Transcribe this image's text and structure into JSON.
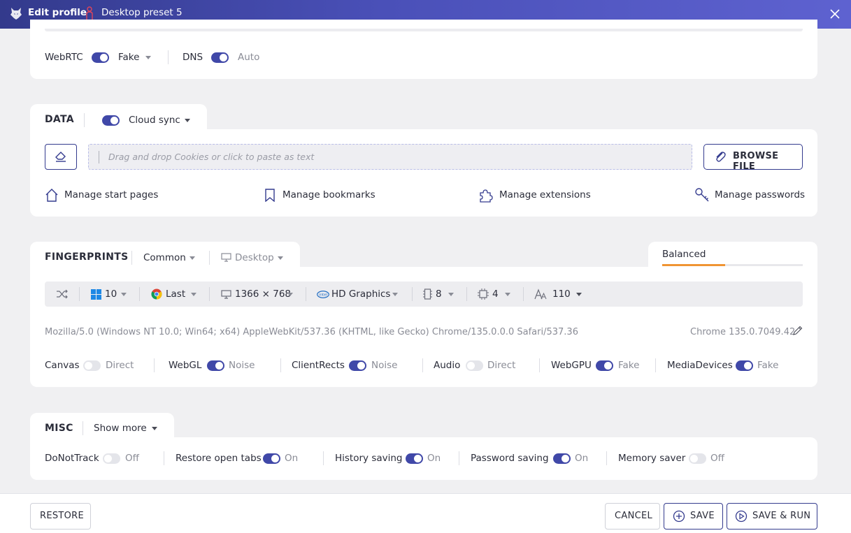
{
  "header": {
    "title": "Edit profile",
    "preset": "Desktop preset 5"
  },
  "network": {
    "webrtc_label": "WebRTC",
    "webrtc_on": true,
    "webrtc_value": "Fake",
    "dns_label": "DNS",
    "dns_on": true,
    "dns_value": "Auto"
  },
  "data": {
    "title": "DATA",
    "cloud_sync_on": true,
    "cloud_sync_label": "Cloud sync",
    "cookies_placeholder": "Drag and drop Cookies or click to paste as text",
    "browse_label": "BROWSE FILE",
    "links": {
      "start_pages": "Manage start pages",
      "bookmarks": "Manage bookmarks",
      "extensions": "Manage extensions",
      "passwords": "Manage passwords"
    }
  },
  "fingerprints": {
    "title": "FINGERPRINTS",
    "mode": "Common",
    "device": "Desktop",
    "balance_label": "Balanced",
    "balance_level_percent": 45,
    "os_version": "10",
    "browser_version": "Last",
    "resolution": "1366 × 768",
    "gpu": "HD Graphics",
    "memory": "8",
    "cpu_cores": "4",
    "fonts_count": "110",
    "user_agent": "Mozilla/5.0 (Windows NT 10.0; Win64; x64) AppleWebKit/537.36 (KHTML, like Gecko) Chrome/135.0.0.0 Safari/537.36",
    "browser_name": "Chrome 135.0.7049.42",
    "toggles": [
      {
        "label": "Canvas",
        "on": false,
        "value": "Direct"
      },
      {
        "label": "WebGL",
        "on": true,
        "value": "Noise"
      },
      {
        "label": "ClientRects",
        "on": true,
        "value": "Noise"
      },
      {
        "label": "Audio",
        "on": false,
        "value": "Direct"
      },
      {
        "label": "WebGPU",
        "on": true,
        "value": "Fake"
      },
      {
        "label": "MediaDevices",
        "on": true,
        "value": "Fake"
      }
    ]
  },
  "misc": {
    "title": "MISC",
    "show_more": "Show more",
    "toggles": [
      {
        "label": "DoNotTrack",
        "on": false,
        "value": "Off"
      },
      {
        "label": "Restore open tabs",
        "on": true,
        "value": "On"
      },
      {
        "label": "History saving",
        "on": true,
        "value": "On"
      },
      {
        "label": "Password saving",
        "on": true,
        "value": "On"
      },
      {
        "label": "Memory saver",
        "on": false,
        "value": "Off"
      }
    ]
  },
  "footer": {
    "restore": "RESTORE",
    "cancel": "CANCEL",
    "save": "SAVE",
    "save_run": "SAVE & RUN"
  },
  "colors": {
    "accent": "#343b8e",
    "toggle_on": "#4048a8",
    "toggle_off": "#e4e5ea",
    "progress": "#f09533",
    "header_start": "#333a8c",
    "header_end": "#5e62d0"
  }
}
